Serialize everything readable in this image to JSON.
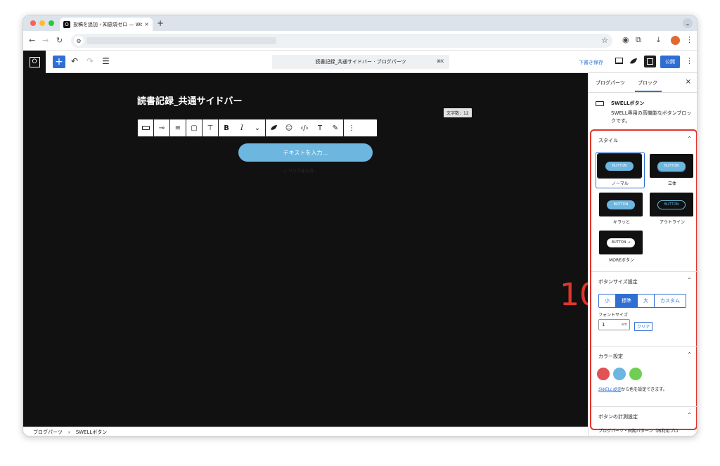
{
  "browser": {
    "tab_title": "投稿を追加 ‹ 知恵袋ゼロ — Wor...",
    "tab_favicon": "O",
    "new_tab": "+",
    "tab_close": "×"
  },
  "toolbar": {
    "logo": "O",
    "add_label": "+",
    "command_title": "読書記録_共通サイドバー · ブログパーツ",
    "command_shortcut": "⌘K",
    "draft_label": "下書き保存",
    "publish_label": "公開"
  },
  "canvas": {
    "post_title": "読書記録_共通サイドバー",
    "word_count": "文字数：12",
    "button_text": "テキストを入力…",
    "sub_text": "✓ リンクを入力..."
  },
  "block_toolbar": {
    "bold": "B",
    "italic": "I",
    "text_t": "T"
  },
  "footer": {
    "crumb1": "ブログパーツ",
    "separator": "›",
    "crumb2": "SWELLボタン"
  },
  "inspector": {
    "tab_blogparts": "ブログパーツ",
    "tab_block": "ブロック",
    "close": "×",
    "block_name": "SWELLボタン",
    "block_desc": "SWELL専用の高機能なボタンブロックです。",
    "style_panel": {
      "title": "スタイル",
      "thumb_text": "BUTTON",
      "more_thumb_text": "BUTTON →",
      "options": [
        "ノーマル",
        "立体",
        "キラッと",
        "アウトライン",
        "MOREボタン"
      ]
    },
    "size_panel": {
      "title": "ボタンサイズ設定",
      "sizes": [
        "小",
        "標準",
        "大",
        "カスタム"
      ],
      "selected": "標準",
      "font_size_label": "フォントサイズ",
      "font_size_value": "1",
      "font_size_unit": "em",
      "clear_label": "クリア"
    },
    "color_panel": {
      "title": "カラー設定",
      "swatches": [
        "#e05253",
        "#6cb6e0",
        "#6fcf53"
      ],
      "note_link": "SWELL設定",
      "note_rest": "から色を設定できます。"
    },
    "measure_panel": {
      "title": "ボタンの計測設定",
      "subtext": "ブログパーツ・同期パターン（再利用ブロ"
    }
  },
  "annotation": "10"
}
